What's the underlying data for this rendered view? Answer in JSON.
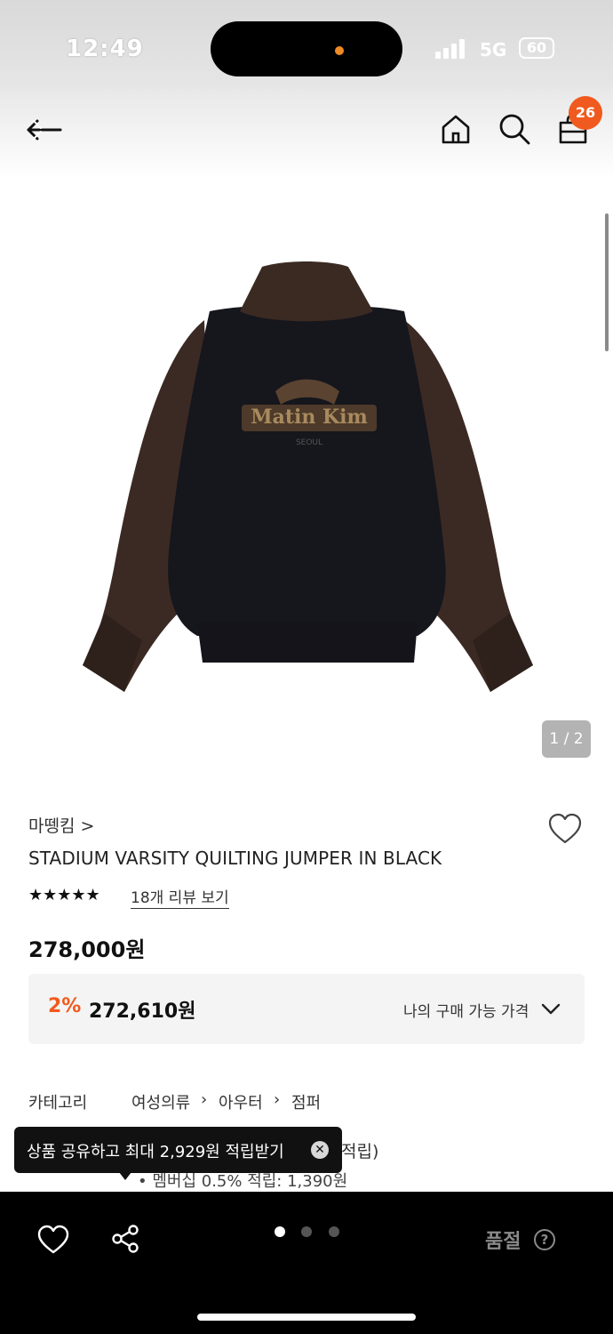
{
  "status_bar": {
    "time": "12:49",
    "network": "5G",
    "battery": "60"
  },
  "header": {
    "cart_count": "26",
    "icons": [
      "back-icon",
      "home-icon",
      "search-icon",
      "shopping-bag-icon"
    ]
  },
  "product": {
    "image_counter": "1 / 2",
    "brand": "마뗑킴 >",
    "name": "STADIUM VARSITY QUILTING JUMPER IN BLACK",
    "rating_value": 4.5,
    "rating_max": 5,
    "stars_text": "★★★★★",
    "review_link": "18개 리뷰 보기",
    "price": "278,000원",
    "member": {
      "discount": "2%",
      "price": "272,610원",
      "label": "나의 구매 가능 가격"
    },
    "category_label": "카테고리",
    "category_path": [
      "여성의류",
      "아우터",
      "점퍼"
    ],
    "points_tail": "적립)",
    "points_line": "•  멤버십 0.5% 적립: 1,390원"
  },
  "tooltip": {
    "text": "상품 공유하고 최대 2,929원 적립받기",
    "close": "✕"
  },
  "bottom_bar": {
    "soldout_label": "품절",
    "help": "?",
    "carousel_active_index": 0,
    "carousel_count": 3
  },
  "colors": {
    "accent": "#f05a1e",
    "bottom_bar": "#000000",
    "soldout_text": "#8a8a8a"
  }
}
